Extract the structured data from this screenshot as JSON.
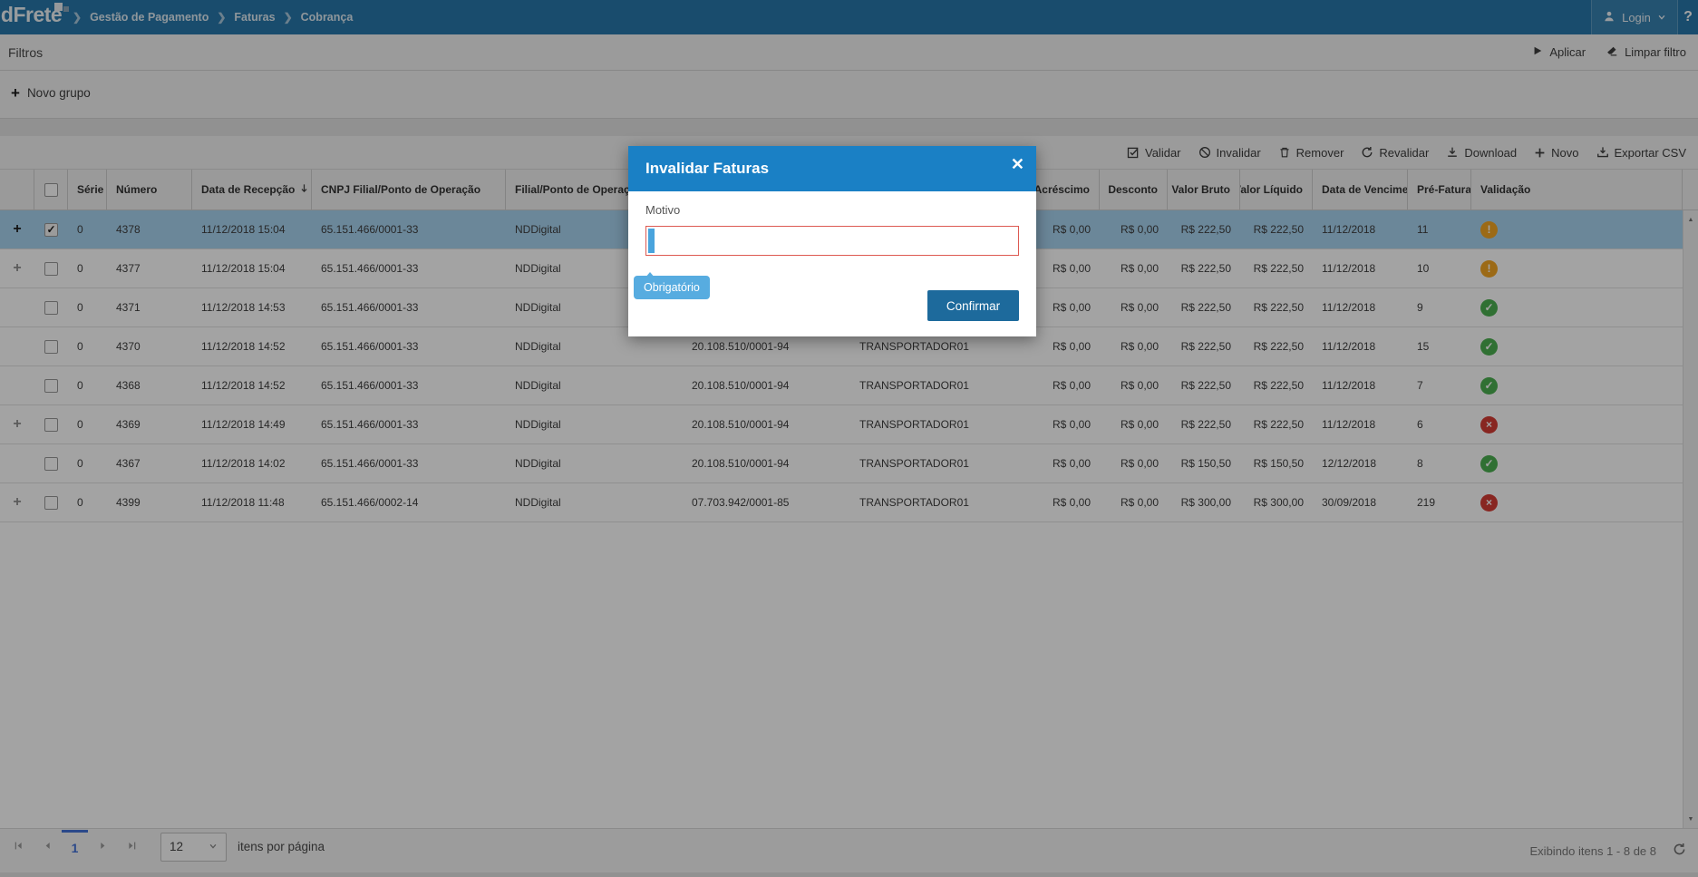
{
  "colors": {
    "navbar_bg": "#2878ab",
    "modal_header_blue": "#1a80c5",
    "confirm_blue": "#1d6a9c",
    "tooltip_blue": "#57ace0",
    "selected_row": "#a8d3f0",
    "validation_red": "#dd5a52",
    "status_ok": "#4caf50",
    "status_warning": "#f5a623",
    "status_error": "#d53c35",
    "pager_active": "#4472d8"
  },
  "navbar": {
    "logo_text": "ldFrete",
    "breadcrumb": [
      "Gestão de Pagamento",
      "Faturas",
      "Cobrança"
    ],
    "login_label": "Login",
    "help_label": "?"
  },
  "filters": {
    "title": "Filtros",
    "apply_label": "Aplicar",
    "clear_label": "Limpar filtro",
    "new_group_label": "Novo grupo"
  },
  "toolbar": {
    "actions": [
      {
        "label": "Validar",
        "icon": "check-square-icon"
      },
      {
        "label": "Invalidar",
        "icon": "ban-icon"
      },
      {
        "label": "Remover",
        "icon": "trash-icon"
      },
      {
        "label": "Revalidar",
        "icon": "refresh-icon"
      },
      {
        "label": "Download",
        "icon": "download-icon"
      },
      {
        "label": "Novo",
        "icon": "plus-icon"
      },
      {
        "label": "Exportar CSV",
        "icon": "export-icon"
      }
    ]
  },
  "table": {
    "columns": [
      {
        "key": "expand",
        "label": "",
        "type": "expand"
      },
      {
        "key": "select",
        "label": "",
        "type": "checkbox"
      },
      {
        "key": "serie",
        "label": "Série"
      },
      {
        "key": "numero",
        "label": "Número"
      },
      {
        "key": "recepcao",
        "label": "Data de Recepção",
        "sorted": "desc"
      },
      {
        "key": "cnpj_filial",
        "label": "CNPJ Filial/Ponto de Operação"
      },
      {
        "key": "filial",
        "label": "Filial/Ponto de Operação"
      },
      {
        "key": "cnpj_transp",
        "label": ""
      },
      {
        "key": "transp",
        "label": ""
      },
      {
        "key": "acrescimo",
        "label": "Acréscimo",
        "align": "right"
      },
      {
        "key": "desconto",
        "label": "Desconto",
        "align": "right"
      },
      {
        "key": "bruto",
        "label": "Valor Bruto",
        "align": "right"
      },
      {
        "key": "liquido",
        "label": "Valor Líquido",
        "align": "right"
      },
      {
        "key": "venc",
        "label": "Data de Vencimento"
      },
      {
        "key": "pre",
        "label": "Pré-Fatura"
      },
      {
        "key": "validacao",
        "label": "Validação",
        "type": "status"
      }
    ],
    "rows": [
      {
        "expand": true,
        "expand_muted": false,
        "checked": true,
        "selected": true,
        "serie": "0",
        "numero": "4378",
        "recepcao": "11/12/2018 15:04",
        "cnpj_filial": "65.151.466/0001-33",
        "filial": "NDDigital",
        "cnpj_transp": "",
        "transp": "",
        "acrescimo": "R$ 0,00",
        "desconto": "R$ 0,00",
        "bruto": "R$ 222,50",
        "liquido": "R$ 222,50",
        "venc": "11/12/2018",
        "pre": "11",
        "status": "warning"
      },
      {
        "expand": true,
        "expand_muted": true,
        "checked": false,
        "selected": false,
        "serie": "0",
        "numero": "4377",
        "recepcao": "11/12/2018 15:04",
        "cnpj_filial": "65.151.466/0001-33",
        "filial": "NDDigital",
        "cnpj_transp": "",
        "transp": "",
        "acrescimo": "R$ 0,00",
        "desconto": "R$ 0,00",
        "bruto": "R$ 222,50",
        "liquido": "R$ 222,50",
        "venc": "11/12/2018",
        "pre": "10",
        "status": "warning"
      },
      {
        "expand": false,
        "expand_muted": false,
        "checked": false,
        "selected": false,
        "serie": "0",
        "numero": "4371",
        "recepcao": "11/12/2018 14:53",
        "cnpj_filial": "65.151.466/0001-33",
        "filial": "NDDigital",
        "cnpj_transp": "",
        "transp": "",
        "acrescimo": "R$ 0,00",
        "desconto": "R$ 0,00",
        "bruto": "R$ 222,50",
        "liquido": "R$ 222,50",
        "venc": "11/12/2018",
        "pre": "9",
        "status": "ok"
      },
      {
        "expand": false,
        "expand_muted": false,
        "checked": false,
        "selected": false,
        "serie": "0",
        "numero": "4370",
        "recepcao": "11/12/2018 14:52",
        "cnpj_filial": "65.151.466/0001-33",
        "filial": "NDDigital",
        "cnpj_transp": "20.108.510/0001-94",
        "transp": "TRANSPORTADOR01",
        "acrescimo": "R$ 0,00",
        "desconto": "R$ 0,00",
        "bruto": "R$ 222,50",
        "liquido": "R$ 222,50",
        "venc": "11/12/2018",
        "pre": "15",
        "status": "ok"
      },
      {
        "expand": false,
        "expand_muted": false,
        "checked": false,
        "selected": false,
        "serie": "0",
        "numero": "4368",
        "recepcao": "11/12/2018 14:52",
        "cnpj_filial": "65.151.466/0001-33",
        "filial": "NDDigital",
        "cnpj_transp": "20.108.510/0001-94",
        "transp": "TRANSPORTADOR01",
        "acrescimo": "R$ 0,00",
        "desconto": "R$ 0,00",
        "bruto": "R$ 222,50",
        "liquido": "R$ 222,50",
        "venc": "11/12/2018",
        "pre": "7",
        "status": "ok"
      },
      {
        "expand": true,
        "expand_muted": true,
        "checked": false,
        "selected": false,
        "serie": "0",
        "numero": "4369",
        "recepcao": "11/12/2018 14:49",
        "cnpj_filial": "65.151.466/0001-33",
        "filial": "NDDigital",
        "cnpj_transp": "20.108.510/0001-94",
        "transp": "TRANSPORTADOR01",
        "acrescimo": "R$ 0,00",
        "desconto": "R$ 0,00",
        "bruto": "R$ 222,50",
        "liquido": "R$ 222,50",
        "venc": "11/12/2018",
        "pre": "6",
        "status": "error"
      },
      {
        "expand": false,
        "expand_muted": false,
        "checked": false,
        "selected": false,
        "serie": "0",
        "numero": "4367",
        "recepcao": "11/12/2018 14:02",
        "cnpj_filial": "65.151.466/0001-33",
        "filial": "NDDigital",
        "cnpj_transp": "20.108.510/0001-94",
        "transp": "TRANSPORTADOR01",
        "acrescimo": "R$ 0,00",
        "desconto": "R$ 0,00",
        "bruto": "R$ 150,50",
        "liquido": "R$ 150,50",
        "venc": "12/12/2018",
        "pre": "8",
        "status": "ok"
      },
      {
        "expand": true,
        "expand_muted": true,
        "checked": false,
        "selected": false,
        "serie": "0",
        "numero": "4399",
        "recepcao": "11/12/2018 11:48",
        "cnpj_filial": "65.151.466/0002-14",
        "filial": "NDDigital",
        "cnpj_transp": "07.703.942/0001-85",
        "transp": "TRANSPORTADOR01",
        "acrescimo": "R$ 0,00",
        "desconto": "R$ 0,00",
        "bruto": "R$ 300,00",
        "liquido": "R$ 300,00",
        "venc": "30/09/2018",
        "pre": "219",
        "status": "error"
      }
    ]
  },
  "modal": {
    "title": "Invalidar Faturas",
    "close_label": "✕",
    "field_label": "Motivo",
    "field_value": "",
    "validation_message": "Obrigatório",
    "confirm_label": "Confirmar"
  },
  "pager": {
    "current_page": "1",
    "page_size": "12",
    "page_size_label": "itens por página",
    "status": "Exibindo itens 1 - 8 de 8"
  }
}
